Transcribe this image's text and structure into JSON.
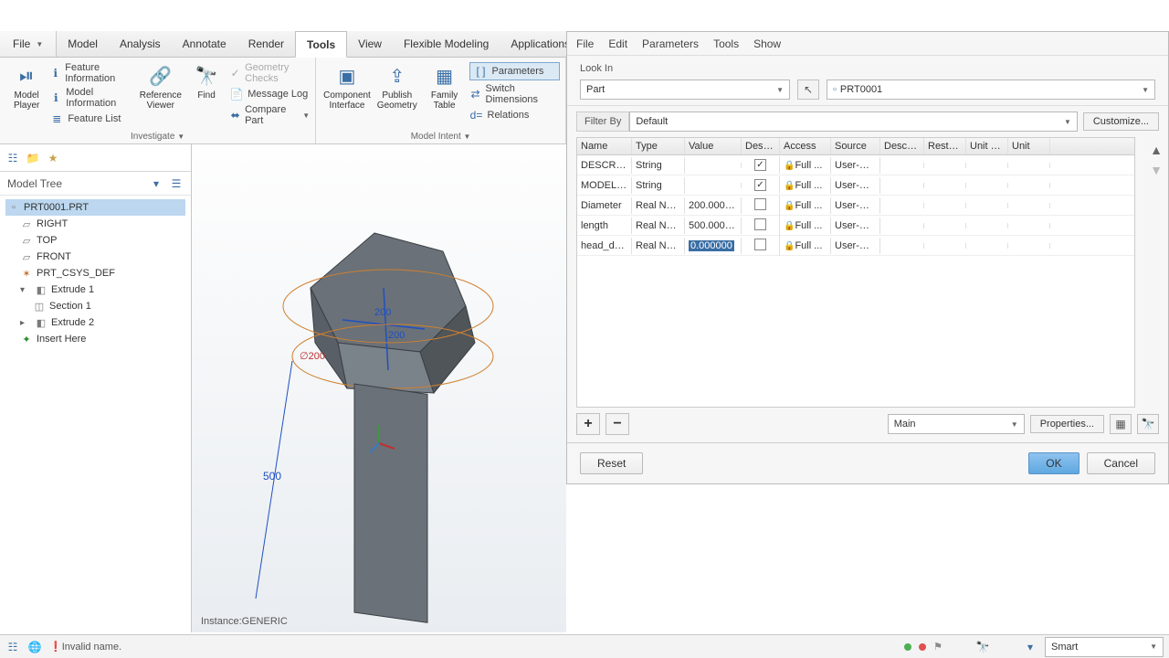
{
  "file_menu": "File",
  "tabs": [
    "Model",
    "Analysis",
    "Annotate",
    "Render",
    "Tools",
    "View",
    "Flexible Modeling",
    "Applications"
  ],
  "active_tab": "Tools",
  "ribbon": {
    "model_player": "Model\nPlayer",
    "feature_info": "Feature Information",
    "model_info": "Model Information",
    "feature_list": "Feature List",
    "reference_viewer": "Reference\nViewer",
    "find": "Find",
    "geometry_checks": "Geometry Checks",
    "message_log": "Message Log",
    "compare_part": "Compare Part",
    "investigate": "Investigate",
    "component_interface": "Component\nInterface",
    "publish_geometry": "Publish\nGeometry",
    "family_table": "Family\nTable",
    "parameters": "Parameters",
    "switch_dim": "Switch Dimensions",
    "relations": "Relations",
    "model_intent": "Model Intent"
  },
  "model_tree": {
    "title": "Model Tree",
    "root": "PRT0001.PRT",
    "items": [
      "RIGHT",
      "TOP",
      "FRONT",
      "PRT_CSYS_DEF"
    ],
    "extrude1": "Extrude 1",
    "section1": "Section 1",
    "extrude2": "Extrude 2",
    "insert_here": "Insert Here"
  },
  "viewport": {
    "dim_200": "200",
    "dim_200b": "200",
    "dim_d200": "∅200",
    "dim_500": "500",
    "instance": "Instance:GENERIC"
  },
  "dialog": {
    "menu": [
      "File",
      "Edit",
      "Parameters",
      "Tools",
      "Show"
    ],
    "lookin_label": "Look In",
    "lookin_type": "Part",
    "lookin_name": "PRT0001",
    "filter_label": "Filter By",
    "filter_value": "Default",
    "customize": "Customize...",
    "cols": [
      "Name",
      "Type",
      "Value",
      "Desig...",
      "Access",
      "Source",
      "Descri...",
      "Restri...",
      "Unit Q...",
      "Unit"
    ],
    "rows": [
      {
        "name": "DESCRIP...",
        "type": "String",
        "value": "",
        "desig": true,
        "access": "Full ...",
        "source": "User-Defi..."
      },
      {
        "name": "MODELE...",
        "type": "String",
        "value": "",
        "desig": true,
        "access": "Full ...",
        "source": "User-Defi..."
      },
      {
        "name": "Diameter",
        "type": "Real Num...",
        "value": "200.0000...",
        "desig": false,
        "access": "Full ...",
        "source": "User-Defi..."
      },
      {
        "name": "length",
        "type": "Real Num...",
        "value": "500.0000...",
        "desig": false,
        "access": "Full ...",
        "source": "User-Defi..."
      },
      {
        "name": "head_de...",
        "type": "Real Num...",
        "value": "0.000000",
        "desig": false,
        "access": "Full ...",
        "source": "User-Defi...",
        "selected": true
      }
    ],
    "main": "Main",
    "properties": "Properties...",
    "reset": "Reset",
    "ok": "OK",
    "cancel": "Cancel"
  },
  "status": {
    "msg": "Invalid name.",
    "mode": "Smart"
  }
}
